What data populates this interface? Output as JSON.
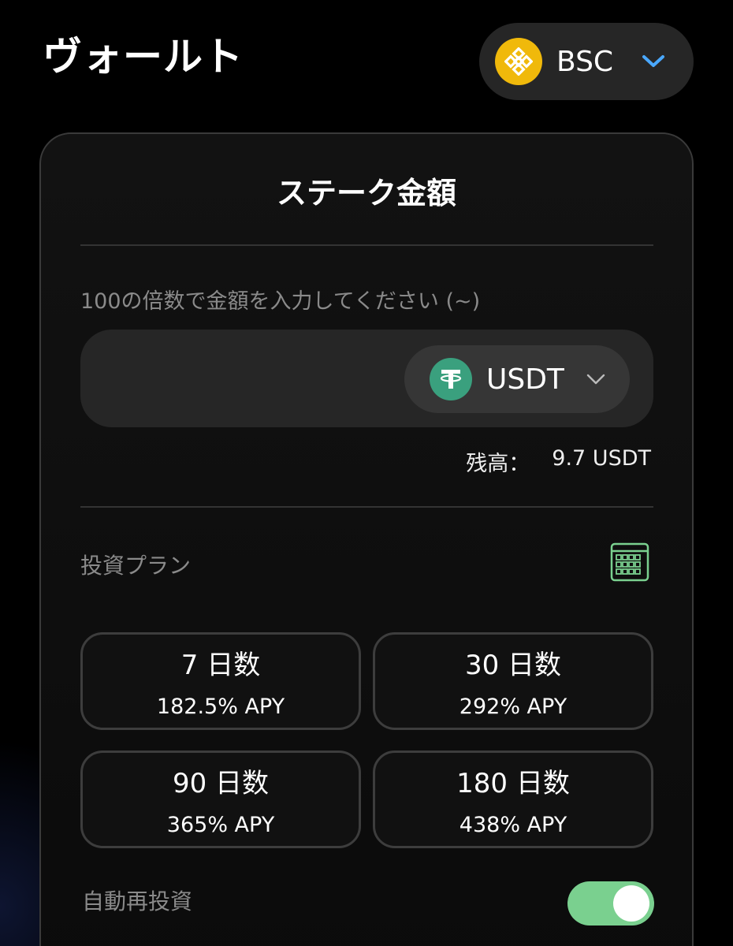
{
  "header": {
    "title": "ヴォールト",
    "chain": {
      "label": "BSC",
      "icon": "bnb-icon",
      "accent": "#f0b90b"
    }
  },
  "stake": {
    "title": "ステーク金額",
    "hint": "100の倍数で金額を入力してください (~)",
    "amount_value": "",
    "token": {
      "label": "USDT",
      "icon": "usdt-icon",
      "accent": "#3aa07e"
    },
    "balance_label": "残高：",
    "balance_value": "9.7 USDT"
  },
  "plans": {
    "label": "投資プラン",
    "icon": "calendar-icon",
    "items": [
      {
        "days": "7 日数",
        "apy": "182.5% APY"
      },
      {
        "days": "30 日数",
        "apy": "292% APY"
      },
      {
        "days": "90 日数",
        "apy": "365% APY"
      },
      {
        "days": "180 日数",
        "apy": "438% APY"
      }
    ]
  },
  "reinvest": {
    "label": "自動再投資",
    "enabled": true,
    "accent": "#7ad08f"
  }
}
